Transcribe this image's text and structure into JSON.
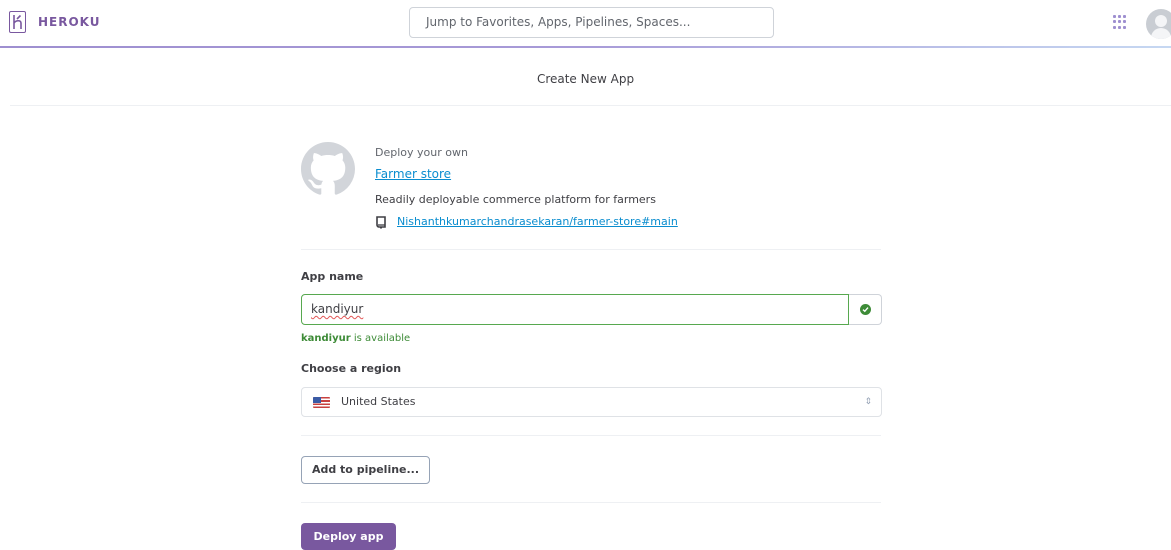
{
  "brand": {
    "name": "HEROKU",
    "accent": "#79589f"
  },
  "nav": {
    "search_placeholder": "Jump to Favorites, Apps, Pipelines, Spaces...",
    "apps_icon": "grid-icon",
    "avatar_icon": "user-avatar"
  },
  "page": {
    "title": "Create New App"
  },
  "deploy": {
    "intro": "Deploy your own",
    "app_title": "Farmer store",
    "description": "Readily deployable commerce platform for farmers",
    "repo": "Nishanthkumarchandrasekaran/farmer-store#main",
    "source_icon": "github-icon"
  },
  "form": {
    "app_name_label": "App name",
    "app_name_value": "kandiyur",
    "availability_name": "kandiyur",
    "availability_text": " is available",
    "status_icon": "check-circle-icon",
    "region_label": "Choose a region",
    "region_value": "United States",
    "pipeline_button": "Add to pipeline...",
    "deploy_button": "Deploy app"
  },
  "colors": {
    "success": "#3d8b37",
    "link": "#0a8dcf",
    "primary_button": "#79589f"
  }
}
